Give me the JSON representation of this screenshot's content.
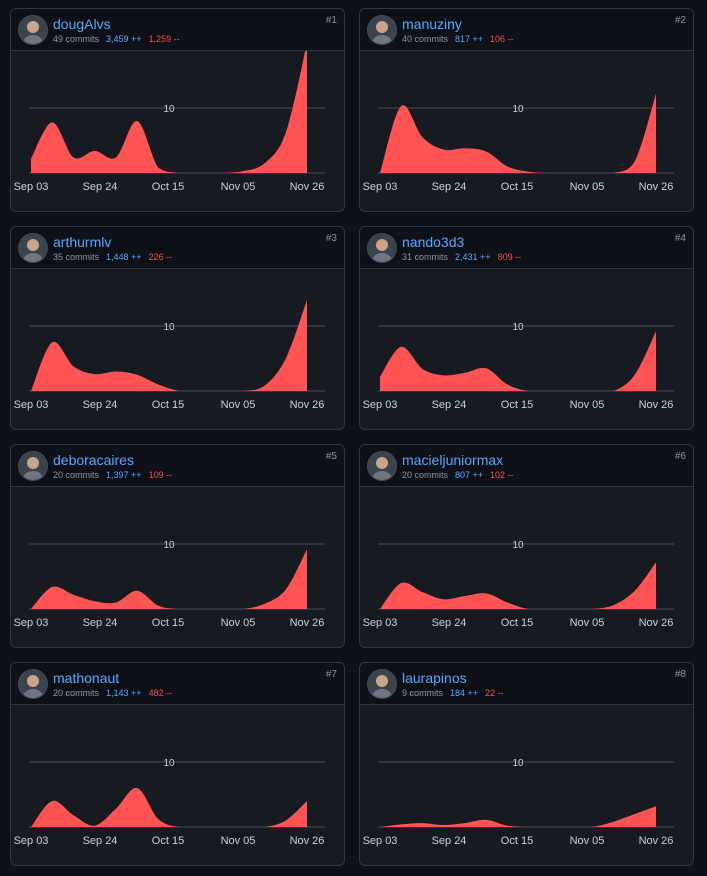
{
  "colors": {
    "area": "#ff5454",
    "username": "#58a6ff",
    "additions": "#58a6ff",
    "deletions": "#f85149"
  },
  "contributors": [
    {
      "rank": "#1",
      "username": "dougAlvs",
      "commits": "49 commits",
      "additions": "3,459 ++",
      "deletions": "1,259 --",
      "avatar_icon": "user-avatar-icon"
    },
    {
      "rank": "#2",
      "username": "manuziny",
      "commits": "40 commits",
      "additions": "817 ++",
      "deletions": "106 --",
      "avatar_icon": "user-avatar-icon"
    },
    {
      "rank": "#3",
      "username": "arthurmlv",
      "commits": "35 commits",
      "additions": "1,448 ++",
      "deletions": "226 --",
      "avatar_icon": "user-avatar-icon"
    },
    {
      "rank": "#4",
      "username": "nando3d3",
      "commits": "31 commits",
      "additions": "2,431 ++",
      "deletions": "809 --",
      "avatar_icon": "user-avatar-icon"
    },
    {
      "rank": "#5",
      "username": "deboracaires",
      "commits": "20 commits",
      "additions": "1,397 ++",
      "deletions": "109 --",
      "avatar_icon": "user-avatar-icon"
    },
    {
      "rank": "#6",
      "username": "macieljuniormax",
      "commits": "20 commits",
      "additions": "807 ++",
      "deletions": "102 --",
      "avatar_icon": "user-avatar-icon"
    },
    {
      "rank": "#7",
      "username": "mathonaut",
      "commits": "20 commits",
      "additions": "1,143 ++",
      "deletions": "482 --",
      "avatar_icon": "user-avatar-icon"
    },
    {
      "rank": "#8",
      "username": "laurapinos",
      "commits": "9 commits",
      "additions": "184 ++",
      "deletions": "22 --",
      "avatar_icon": "user-avatar-icon"
    }
  ],
  "chart_data": [
    {
      "type": "area",
      "series": [
        {
          "x": [
            0,
            1,
            2,
            3,
            4,
            5,
            6,
            7,
            8,
            9,
            10,
            11,
            12,
            13
          ],
          "values": [
            2.2,
            7.8,
            2.4,
            3.4,
            2.4,
            8.0,
            0.8,
            0,
            0,
            0,
            0.3,
            1.5,
            6.2,
            20
          ]
        }
      ]
    },
    {
      "type": "area",
      "series": [
        {
          "x": [
            0,
            1,
            2,
            3,
            4,
            5,
            6,
            7,
            8,
            9,
            10,
            11,
            12,
            13
          ],
          "values": [
            0,
            10.3,
            5.5,
            3.6,
            3.8,
            3.3,
            1.0,
            0.2,
            0,
            0,
            0,
            0,
            1.8,
            12.2
          ]
        }
      ]
    },
    {
      "type": "area",
      "series": [
        {
          "x": [
            0,
            1,
            2,
            3,
            4,
            5,
            6,
            7,
            8,
            9,
            10,
            11,
            12,
            13
          ],
          "values": [
            0,
            7.5,
            3.8,
            2.6,
            3.0,
            2.5,
            1.0,
            0,
            0,
            0,
            0,
            0.8,
            5.0,
            14.0
          ]
        }
      ]
    },
    {
      "type": "area",
      "series": [
        {
          "x": [
            0,
            1,
            2,
            3,
            4,
            5,
            6,
            7,
            8,
            9,
            10,
            11,
            12,
            13
          ],
          "values": [
            2.2,
            6.8,
            3.4,
            2.4,
            2.8,
            3.5,
            1.0,
            0,
            0,
            0,
            0,
            0,
            2.5,
            9.2
          ]
        }
      ]
    },
    {
      "type": "area",
      "series": [
        {
          "x": [
            0,
            1,
            2,
            3,
            4,
            5,
            6,
            7,
            8,
            9,
            10,
            11,
            12,
            13
          ],
          "values": [
            0,
            3.4,
            2.2,
            1.2,
            1.0,
            2.8,
            0.5,
            0,
            0,
            0,
            0,
            0.8,
            3.0,
            9.2
          ]
        }
      ]
    },
    {
      "type": "area",
      "series": [
        {
          "x": [
            0,
            1,
            2,
            3,
            4,
            5,
            6,
            7,
            8,
            9,
            10,
            11,
            12,
            13
          ],
          "values": [
            0,
            4.0,
            2.6,
            1.5,
            2.0,
            2.4,
            1.0,
            0,
            0,
            0,
            0,
            0.6,
            2.8,
            7.2
          ]
        }
      ]
    },
    {
      "type": "area",
      "series": [
        {
          "x": [
            0,
            1,
            2,
            3,
            4,
            5,
            6,
            7,
            8,
            9,
            10,
            11,
            12,
            13
          ],
          "values": [
            0,
            4.0,
            1.8,
            0.2,
            2.8,
            6.0,
            1.2,
            0,
            0,
            0,
            0,
            0,
            1.0,
            4.0
          ]
        }
      ]
    },
    {
      "type": "area",
      "series": [
        {
          "x": [
            0,
            1,
            2,
            3,
            4,
            5,
            6,
            7,
            8,
            9,
            10,
            11,
            12,
            13
          ],
          "values": [
            0,
            0.4,
            0.6,
            0.3,
            0.6,
            1.1,
            0.2,
            0,
            0,
            0,
            0,
            0.8,
            2.0,
            3.2
          ]
        }
      ]
    }
  ],
  "axis": {
    "x_ticks": [
      {
        "x": 0,
        "label": "Sep 03"
      },
      {
        "x": 3,
        "label": "Sep 24"
      },
      {
        "x": 6,
        "label": "Oct 15"
      },
      {
        "x": 9,
        "label": "Nov 05"
      },
      {
        "x": 12,
        "label": "Nov 26"
      }
    ],
    "x_range": [
      0,
      13
    ],
    "y_range": [
      0,
      10
    ],
    "y_label": "10",
    "gridline": 10
  }
}
